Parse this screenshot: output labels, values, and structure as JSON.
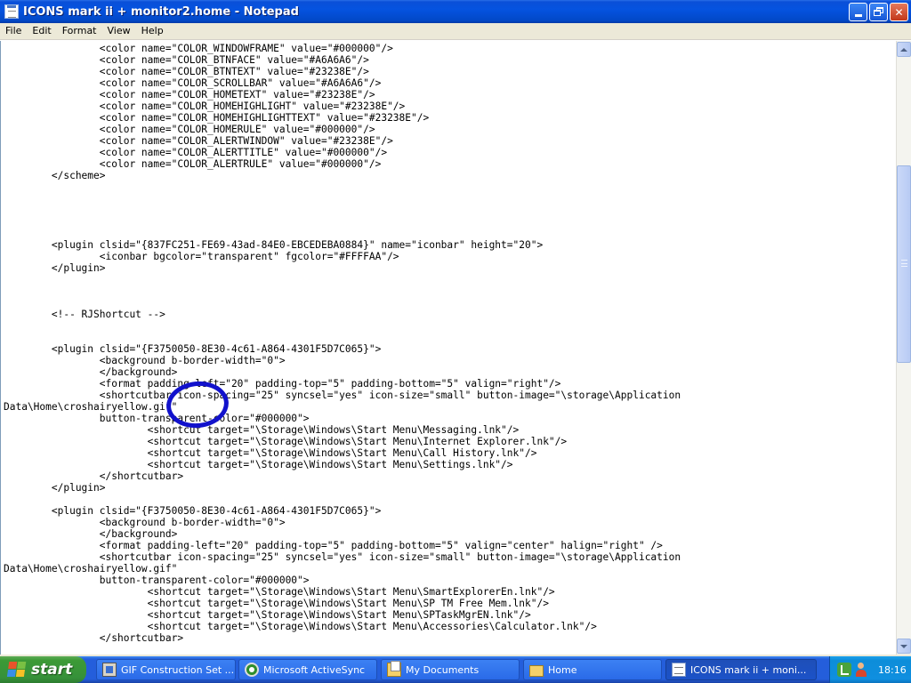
{
  "window": {
    "title": "ICONS mark ii + monitor2.home - Notepad"
  },
  "menu": [
    "File",
    "Edit",
    "Format",
    "View",
    "Help"
  ],
  "editor": {
    "lines": [
      "                <color name=\"COLOR_WINDOWFRAME\" value=\"#000000\"/>",
      "                <color name=\"COLOR_BTNFACE\" value=\"#A6A6A6\"/>",
      "                <color name=\"COLOR_BTNTEXT\" value=\"#23238E\"/>",
      "                <color name=\"COLOR_SCROLLBAR\" value=\"#A6A6A6\"/>",
      "                <color name=\"COLOR_HOMETEXT\" value=\"#23238E\"/>",
      "                <color name=\"COLOR_HOMEHIGHLIGHT\" value=\"#23238E\"/>",
      "                <color name=\"COLOR_HOMEHIGHLIGHTTEXT\" value=\"#23238E\"/>",
      "                <color name=\"COLOR_HOMERULE\" value=\"#000000\"/>",
      "                <color name=\"COLOR_ALERTWINDOW\" value=\"#23238E\"/>",
      "                <color name=\"COLOR_ALERTTITLE\" value=\"#000000\"/>",
      "                <color name=\"COLOR_ALERTRULE\" value=\"#000000\"/>",
      "        </scheme>",
      "",
      "",
      "",
      "",
      "",
      "        <plugin clsid=\"{837FC251-FE69-43ad-84E0-EBCEDEBA0884}\" name=\"iconbar\" height=\"20\">",
      "                <iconbar bgcolor=\"transparent\" fgcolor=\"#FFFFAA\"/>",
      "        </plugin>",
      "",
      "",
      "",
      "        <!-- RJShortcut -->",
      "",
      "",
      "        <plugin clsid=\"{F3750050-8E30-4c61-A864-4301F5D7C065}\">",
      "                <background b-border-width=\"0\">",
      "                </background>",
      "                <format padding-left=\"20\" padding-top=\"5\" padding-bottom=\"5\" valign=\"right\"/>",
      "                <shortcutbar icon-spacing=\"25\" syncsel=\"yes\" icon-size=\"small\" button-image=\"\\storage\\Application",
      "Data\\Home\\croshairyellow.gif\"",
      "                button-transparent-color=\"#000000\">",
      "                        <shortcut target=\"\\Storage\\Windows\\Start Menu\\Messaging.lnk\"/>",
      "                        <shortcut target=\"\\Storage\\Windows\\Start Menu\\Internet Explorer.lnk\"/>",
      "                        <shortcut target=\"\\Storage\\Windows\\Start Menu\\Call History.lnk\"/>",
      "                        <shortcut target=\"\\Storage\\Windows\\Start Menu\\Settings.lnk\"/>",
      "                </shortcutbar>",
      "        </plugin>",
      "",
      "        <plugin clsid=\"{F3750050-8E30-4c61-A864-4301F5D7C065}\">",
      "                <background b-border-width=\"0\">",
      "                </background>",
      "                <format padding-left=\"20\" padding-top=\"5\" padding-bottom=\"5\" valign=\"center\" halign=\"right\" />",
      "                <shortcutbar icon-spacing=\"25\" syncsel=\"yes\" icon-size=\"small\" button-image=\"\\storage\\Application",
      "Data\\Home\\croshairyellow.gif\"",
      "                button-transparent-color=\"#000000\">",
      "                        <shortcut target=\"\\Storage\\Windows\\Start Menu\\SmartExplorerEn.lnk\"/>",
      "                        <shortcut target=\"\\Storage\\Windows\\Start Menu\\SP TM Free Mem.lnk\"/>",
      "                        <shortcut target=\"\\Storage\\Windows\\Start Menu\\SPTaskMgrEN.lnk\"/>",
      "                        <shortcut target=\"\\Storage\\Windows\\Start Menu\\Accessories\\Calculator.lnk\"/>",
      "                </shortcutbar>"
    ]
  },
  "taskbar": {
    "start_label": "start",
    "tasks": [
      {
        "label": "GIF Construction Set ...",
        "icon": "gif-construction-icon",
        "active": false
      },
      {
        "label": "Microsoft ActiveSync",
        "icon": "activesync-icon",
        "active": false
      },
      {
        "label": "My Documents",
        "icon": "my-documents-icon",
        "active": false
      },
      {
        "label": "Home",
        "icon": "folder-icon",
        "active": false
      },
      {
        "label": "ICONS mark ii + moni...",
        "icon": "notepad-icon",
        "active": true
      }
    ],
    "clock": "18:16"
  },
  "colors": {
    "titlebar": "#0553e0",
    "taskbar": "#245edb",
    "start": "#3c9a36",
    "annotation_circle": "#1212cc"
  }
}
